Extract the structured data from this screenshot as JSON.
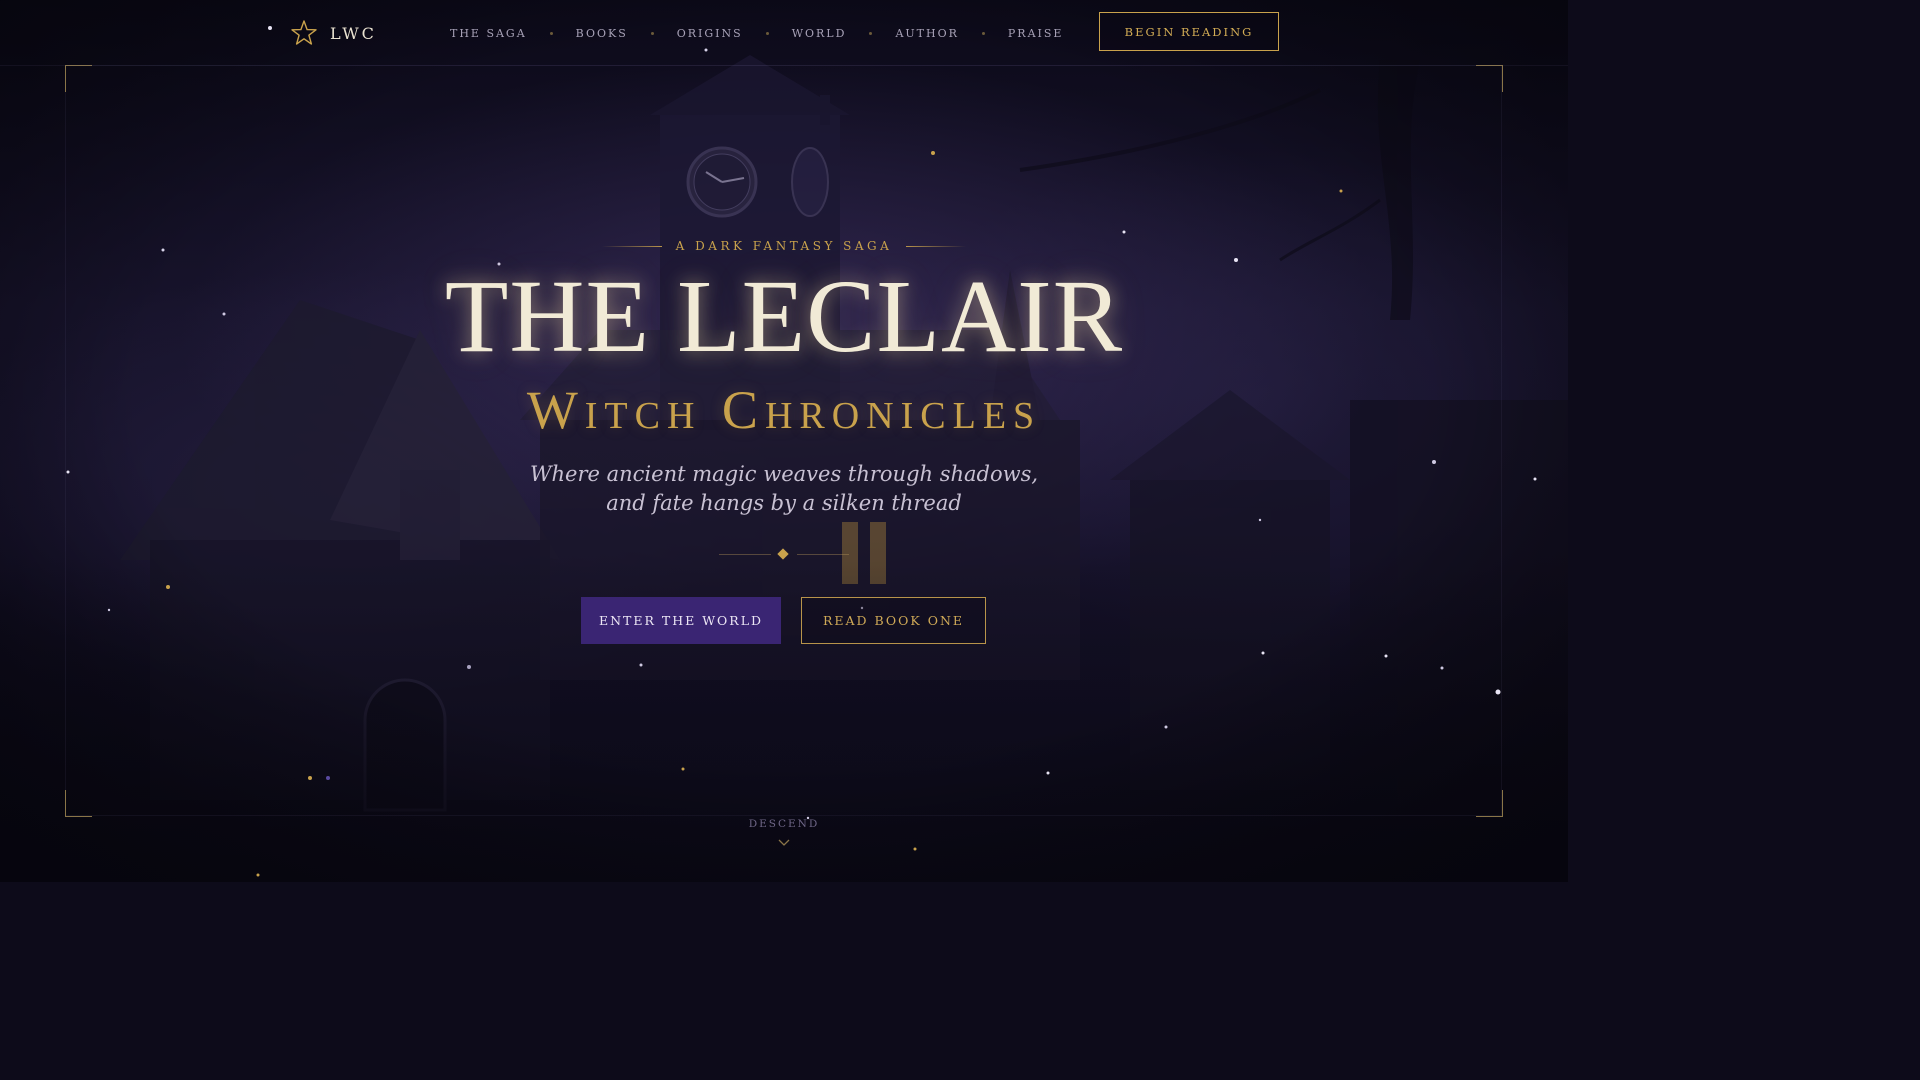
{
  "nav": {
    "logo_icon": "star-outline-icon",
    "logo_text": "LWC",
    "links": [
      "THE SAGA",
      "BOOKS",
      "ORIGINS",
      "WORLD",
      "AUTHOR",
      "PRAISE"
    ],
    "cta_label": "BEGIN READING"
  },
  "hero": {
    "eyebrow": "A DARK FANTASY SAGA",
    "title": "THE LECLAIR",
    "subtitle": "Witch Chronicles",
    "tagline_line1": "Where ancient magic weaves through shadows,",
    "tagline_line2": "and fate hangs by a silken thread",
    "primary_button": "ENTER THE WORLD",
    "secondary_button": "READ BOOK ONE"
  },
  "scroll_hint": {
    "label": "DESCEND",
    "icon": "chevron-down-icon"
  },
  "colors": {
    "gold": "#c9a24c",
    "purple": "#3a2573",
    "background": "#0d0b1a",
    "title": "#f1ead6"
  }
}
